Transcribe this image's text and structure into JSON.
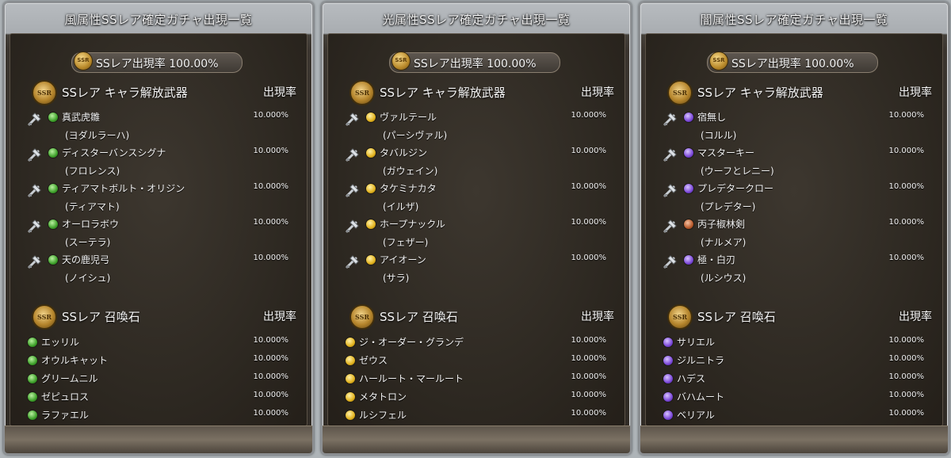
{
  "panels": [
    {
      "title": "風属性SSレア確定ガチャ出現一覧",
      "rate_label": "SSレア出現率 100.00%",
      "weapons_heading": "SSレア キャラ解放武器",
      "summons_heading": "SSレア 召喚石",
      "rate_col": "出現率",
      "element": "wind",
      "weapons": [
        {
          "name": "真武虎雛",
          "chara": "(ヨダルラーハ)",
          "rate": "10.000%"
        },
        {
          "name": "ディスターバンスシグナ",
          "chara": "(フロレンス)",
          "rate": "10.000%"
        },
        {
          "name": "ティアマトボルト・オリジン",
          "chara": "(ティアマト)",
          "rate": "10.000%"
        },
        {
          "name": "オーロラボウ",
          "chara": "(スーテラ)",
          "rate": "10.000%"
        },
        {
          "name": "天の鹿児弓",
          "chara": "(ノイシュ)",
          "rate": "10.000%"
        }
      ],
      "summons": [
        {
          "name": "エッリル",
          "rate": "10.000%"
        },
        {
          "name": "オウルキャット",
          "rate": "10.000%"
        },
        {
          "name": "グリームニル",
          "rate": "10.000%"
        },
        {
          "name": "ゼピュロス",
          "rate": "10.000%"
        },
        {
          "name": "ラファエル",
          "rate": "10.000%"
        }
      ]
    },
    {
      "title": "光属性SSレア確定ガチャ出現一覧",
      "rate_label": "SSレア出現率 100.00%",
      "weapons_heading": "SSレア キャラ解放武器",
      "summons_heading": "SSレア 召喚石",
      "rate_col": "出現率",
      "element": "light",
      "weapons": [
        {
          "name": "ヴァルテール",
          "chara": "(パーシヴァル)",
          "rate": "10.000%"
        },
        {
          "name": "タバルジン",
          "chara": "(ガウェイン)",
          "rate": "10.000%"
        },
        {
          "name": "タケミナカタ",
          "chara": "(イルザ)",
          "rate": "10.000%"
        },
        {
          "name": "ホープナックル",
          "chara": "(フェザー)",
          "rate": "10.000%"
        },
        {
          "name": "アイオーン",
          "chara": "(サラ)",
          "rate": "10.000%"
        }
      ],
      "summons": [
        {
          "name": "ジ・オーダー・グランデ",
          "rate": "10.000%"
        },
        {
          "name": "ゼウス",
          "rate": "10.000%"
        },
        {
          "name": "ハールート・マールート",
          "rate": "10.000%"
        },
        {
          "name": "メタトロン",
          "rate": "10.000%"
        },
        {
          "name": "ルシフェル",
          "rate": "10.000%"
        }
      ]
    },
    {
      "title": "闇属性SSレア確定ガチャ出現一覧",
      "rate_label": "SSレア出現率 100.00%",
      "weapons_heading": "SSレア キャラ解放武器",
      "summons_heading": "SSレア 召喚石",
      "rate_col": "出現率",
      "element": "dark",
      "weapons": [
        {
          "name": "宿無し",
          "chara": "(コルル)",
          "rate": "10.000%"
        },
        {
          "name": "マスターキー",
          "chara": "(ウーフとレニー)",
          "rate": "10.000%"
        },
        {
          "name": "プレデタークロー",
          "chara": "(プレデター)",
          "rate": "10.000%"
        },
        {
          "name": "丙子椒林剣",
          "chara": "(ナルメア)",
          "rate": "10.000%"
        },
        {
          "name": "極・白刃",
          "chara": "(ルシウス)",
          "rate": "10.000%"
        }
      ],
      "summons": [
        {
          "name": "サリエル",
          "rate": "10.000%"
        },
        {
          "name": "ジルニトラ",
          "rate": "10.000%"
        },
        {
          "name": "ハデス",
          "rate": "10.000%"
        },
        {
          "name": "バハムート",
          "rate": "10.000%"
        },
        {
          "name": "ベリアル",
          "rate": "10.000%"
        }
      ]
    }
  ],
  "badge_text": "SSR",
  "weapon_orb_overrides": {
    "2": {
      "3": "fire"
    }
  }
}
